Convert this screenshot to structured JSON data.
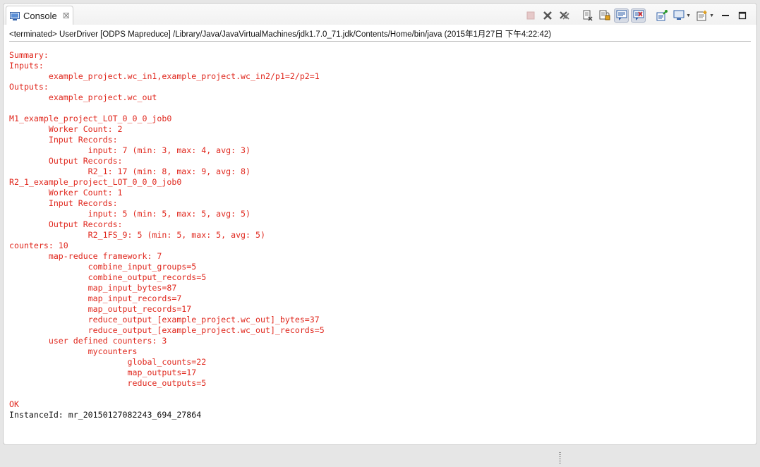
{
  "tab": {
    "label": "Console",
    "close_glyph": "☒"
  },
  "toolbar": {
    "buttons": [
      {
        "name": "terminate-icon",
        "pressed": false
      },
      {
        "name": "remove-launch-icon",
        "pressed": false
      },
      {
        "name": "remove-all-terminated-icon",
        "pressed": false
      },
      {
        "name": "clear-console-icon",
        "pressed": false
      },
      {
        "name": "scroll-lock-icon",
        "pressed": false
      },
      {
        "name": "show-on-stdout-icon",
        "pressed": true
      },
      {
        "name": "show-on-stderr-icon",
        "pressed": true
      },
      {
        "name": "pin-console-icon",
        "pressed": false
      },
      {
        "name": "display-selected-console-icon",
        "pressed": false
      },
      {
        "name": "open-console-icon",
        "pressed": false
      }
    ],
    "minimize_glyph": "—",
    "maximize_glyph": "□"
  },
  "status_line": "<terminated> UserDriver [ODPS Mapreduce] /Library/Java/JavaVirtualMachines/jdk1.7.0_71.jdk/Contents/Home/bin/java (2015年1月27日 下午4:22:42)",
  "console_lines": [
    {
      "text": "Summary:",
      "stream": "err"
    },
    {
      "text": "Inputs:",
      "stream": "err"
    },
    {
      "text": "        example_project.wc_in1,example_project.wc_in2/p1=2/p2=1",
      "stream": "err"
    },
    {
      "text": "Outputs:",
      "stream": "err"
    },
    {
      "text": "        example_project.wc_out",
      "stream": "err"
    },
    {
      "text": "",
      "stream": "err"
    },
    {
      "text": "M1_example_project_LOT_0_0_0_job0",
      "stream": "err"
    },
    {
      "text": "        Worker Count: 2",
      "stream": "err"
    },
    {
      "text": "        Input Records:",
      "stream": "err"
    },
    {
      "text": "                input: 7 (min: 3, max: 4, avg: 3)",
      "stream": "err"
    },
    {
      "text": "        Output Records:",
      "stream": "err"
    },
    {
      "text": "                R2_1: 17 (min: 8, max: 9, avg: 8)",
      "stream": "err"
    },
    {
      "text": "R2_1_example_project_LOT_0_0_0_job0",
      "stream": "err"
    },
    {
      "text": "        Worker Count: 1",
      "stream": "err"
    },
    {
      "text": "        Input Records:",
      "stream": "err"
    },
    {
      "text": "                input: 5 (min: 5, max: 5, avg: 5)",
      "stream": "err"
    },
    {
      "text": "        Output Records:",
      "stream": "err"
    },
    {
      "text": "                R2_1FS_9: 5 (min: 5, max: 5, avg: 5)",
      "stream": "err"
    },
    {
      "text": "counters: 10",
      "stream": "err"
    },
    {
      "text": "        map-reduce framework: 7",
      "stream": "err"
    },
    {
      "text": "                combine_input_groups=5",
      "stream": "err"
    },
    {
      "text": "                combine_output_records=5",
      "stream": "err"
    },
    {
      "text": "                map_input_bytes=87",
      "stream": "err"
    },
    {
      "text": "                map_input_records=7",
      "stream": "err"
    },
    {
      "text": "                map_output_records=17",
      "stream": "err"
    },
    {
      "text": "                reduce_output_[example_project.wc_out]_bytes=37",
      "stream": "err"
    },
    {
      "text": "                reduce_output_[example_project.wc_out]_records=5",
      "stream": "err"
    },
    {
      "text": "        user defined counters: 3",
      "stream": "err"
    },
    {
      "text": "                mycounters",
      "stream": "err"
    },
    {
      "text": "                        global_counts=22",
      "stream": "err"
    },
    {
      "text": "                        map_outputs=17",
      "stream": "err"
    },
    {
      "text": "                        reduce_outputs=5",
      "stream": "err"
    },
    {
      "text": "",
      "stream": "err"
    },
    {
      "text": "OK",
      "stream": "err"
    },
    {
      "text": "InstanceId: mr_20150127082243_694_27864",
      "stream": "out"
    }
  ],
  "colors": {
    "stderr": "#e0281e",
    "stdout": "#111111",
    "tab_icon": "#2f5fa8"
  }
}
